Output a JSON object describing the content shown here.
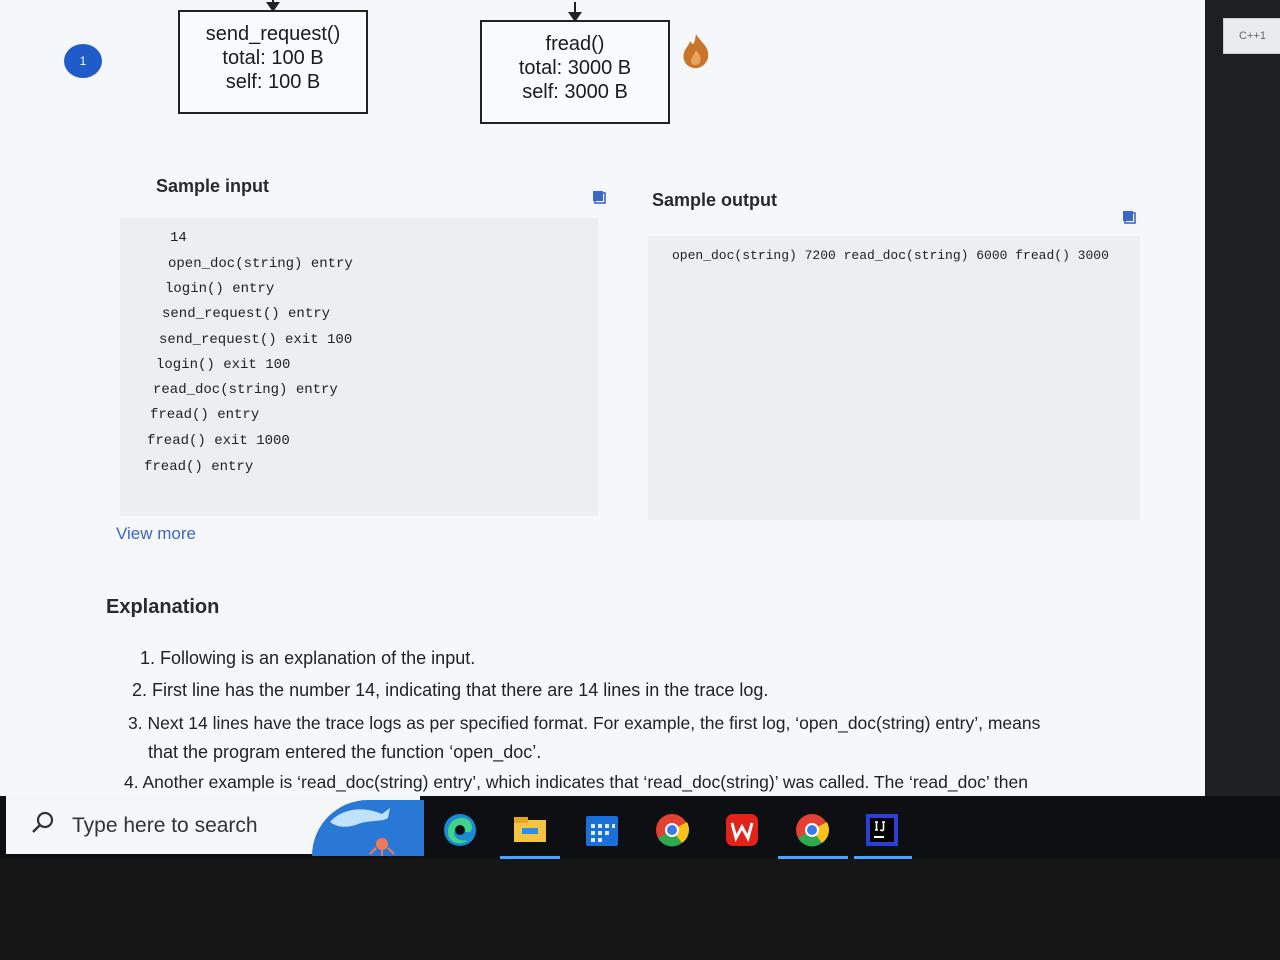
{
  "step_badge": "1",
  "nodes": [
    {
      "name": "send_request()",
      "total": "total: 100 B",
      "self": "self: 100 B"
    },
    {
      "name": "fread()",
      "total": "total: 3000 B",
      "self": "self: 3000 B"
    }
  ],
  "sample_input": {
    "title": "Sample input",
    "lines": [
      "14",
      "open_doc(string) entry",
      "login() entry",
      "send_request() entry",
      "send_request() exit 100",
      "login() exit 100",
      "read_doc(string) entry",
      "fread() entry",
      "fread() exit 1000",
      "fread() entry"
    ]
  },
  "sample_output": {
    "title": "Sample output",
    "line": "open_doc(string) 7200 read_doc(string) 6000 fread() 3000"
  },
  "view_more": "View more",
  "explanation": {
    "title": "Explanation",
    "items": [
      "1. Following is an explanation of the input.",
      "2. First line has the number 14, indicating that there are 14 lines in the trace log.",
      "3. Next 14 lines have the trace logs as per specified format. For example, the first log, ‘open_doc(string) entry’, means",
      "that the program entered the function ‘open_doc’.",
      "4. Another example is ‘read_doc(string) entry’, which indicates that ‘read_doc(string)’ was called. The ‘read_doc’ then"
    ]
  },
  "right_tab": "C++1",
  "taskbar": {
    "search_placeholder": "Type here to search",
    "icons": [
      "edge-icon",
      "file-explorer-icon",
      "calendar-icon",
      "chrome-icon",
      "wps-office-icon",
      "chrome-icon",
      "intellij-icon"
    ]
  }
}
